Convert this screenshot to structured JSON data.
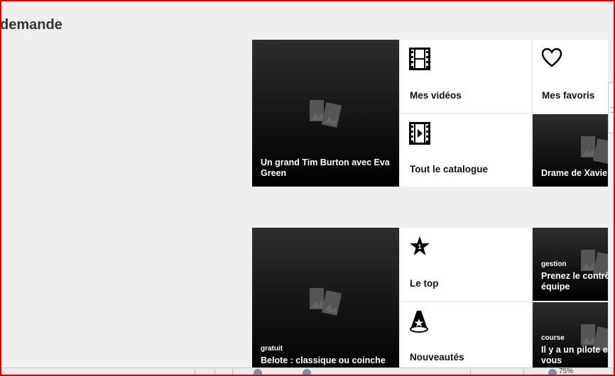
{
  "page": {
    "title": "demande"
  },
  "row1": {
    "hero": {
      "title": "Un grand Tim Burton avec Eva Green"
    },
    "my_videos": {
      "label": "Mes vidéos",
      "icon": "film-strip-icon"
    },
    "favorites": {
      "label": "Mes favoris",
      "icon": "heart-outline-icon"
    },
    "catalog": {
      "label": "Tout le catalogue",
      "icon": "film-play-icon"
    },
    "side": {
      "title": "Drame de Xavier"
    }
  },
  "row2": {
    "hero": {
      "tag": "gratuit",
      "title": "Belote : classique ou coinche"
    },
    "top": {
      "label": "Le top",
      "icon": "star-rank-icon"
    },
    "new": {
      "label": "Nouveautés",
      "icon": "spotlight-star-icon"
    },
    "side1": {
      "tag": "gestion",
      "title": "Prenez le contrôle équipe"
    },
    "side2": {
      "tag": "course",
      "title": "Il y a un pilote en vous"
    }
  },
  "statusbar": {
    "zoom": "75%"
  },
  "colors": {
    "frame": "#e00000",
    "tile_dark": "#000000",
    "background": "#efefef"
  }
}
